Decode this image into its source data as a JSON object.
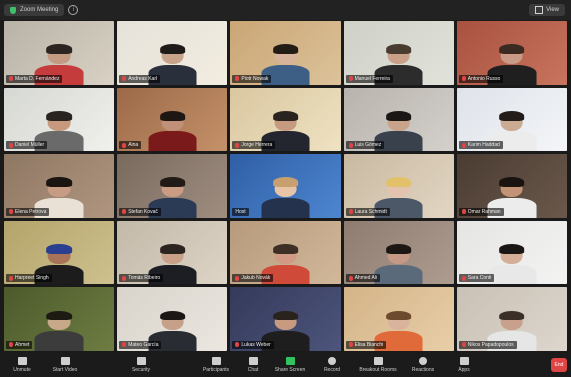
{
  "window": {
    "meeting_title": "Zoom Meeting",
    "view_label": "View"
  },
  "participants": [
    {
      "name": "Marta D. Fernández",
      "muted": true
    },
    {
      "name": "Andreas Karl",
      "muted": true
    },
    {
      "name": "Piotr Nowak",
      "muted": true
    },
    {
      "name": "Manuel Ferreira",
      "muted": true
    },
    {
      "name": "Antonio Russo",
      "muted": true
    },
    {
      "name": "Daniel Müller",
      "muted": true
    },
    {
      "name": "Aina",
      "muted": true
    },
    {
      "name": "Jorge Herrera",
      "muted": true
    },
    {
      "name": "Luis Gómez",
      "muted": true
    },
    {
      "name": "Karim Haddad",
      "muted": true
    },
    {
      "name": "Elena Petrova",
      "muted": true
    },
    {
      "name": "Stefan Kovač",
      "muted": true
    },
    {
      "name": "Host",
      "muted": false
    },
    {
      "name": "Laura Schmidt",
      "muted": true
    },
    {
      "name": "Omar Rahman",
      "muted": true
    },
    {
      "name": "Harpreet Singh",
      "muted": true
    },
    {
      "name": "Tomás Ribeiro",
      "muted": true
    },
    {
      "name": "Jakub Novák",
      "muted": true
    },
    {
      "name": "Ahmed Ali",
      "muted": true
    },
    {
      "name": "Sara Conti",
      "muted": true
    },
    {
      "name": "Ahmet",
      "muted": true
    },
    {
      "name": "Mateo García",
      "muted": true
    },
    {
      "name": "Lukas Weber",
      "muted": true
    },
    {
      "name": "Elisa Bianchi",
      "muted": true
    },
    {
      "name": "Nikos Papadopoulos",
      "muted": true
    }
  ],
  "toolbar": {
    "items": [
      {
        "label": "Unmute",
        "icon": "microphone-icon"
      },
      {
        "label": "Start Video",
        "icon": "video-camera-icon"
      },
      {
        "label": "Security",
        "icon": "shield-icon"
      },
      {
        "label": "Participants",
        "icon": "people-icon"
      },
      {
        "label": "Chat",
        "icon": "chat-icon"
      },
      {
        "label": "Share Screen",
        "icon": "share-screen-icon"
      },
      {
        "label": "Record",
        "icon": "record-icon"
      },
      {
        "label": "Breakout Rooms",
        "icon": "breakout-icon"
      },
      {
        "label": "Reactions",
        "icon": "reaction-icon"
      },
      {
        "label": "Apps",
        "icon": "apps-icon"
      }
    ],
    "end_label": "End"
  },
  "colors": {
    "background": "#1a1a1a",
    "share_green": "#32c25e",
    "mute_red": "#e04545"
  }
}
